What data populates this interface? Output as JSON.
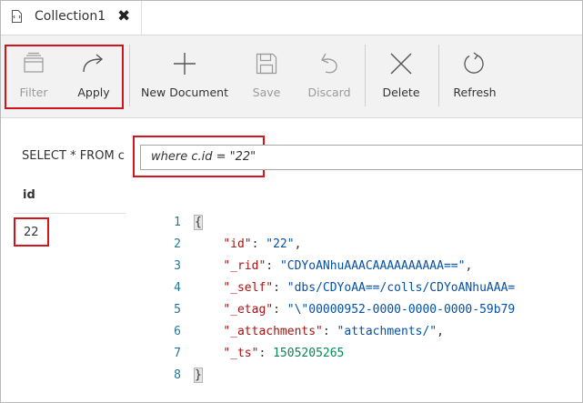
{
  "tab": {
    "title": "Collection1",
    "close": "✖"
  },
  "toolbar": {
    "filter_label": "Filter",
    "apply_label": "Apply",
    "new_document_label": "New Document",
    "save_label": "Save",
    "discard_label": "Discard",
    "delete_label": "Delete",
    "refresh_label": "Refresh"
  },
  "query": {
    "prefix": "SELECT * FROM c",
    "value": "where c.id = \"22\""
  },
  "results": {
    "column_header": "id",
    "rows": [
      "22"
    ]
  },
  "editor": {
    "line_numbers": [
      "1",
      "2",
      "3",
      "4",
      "5",
      "6",
      "7",
      "8"
    ],
    "lines": [
      {
        "open": "{"
      },
      {
        "key": "\"id\"",
        "value": "\"22\"",
        "trail": ","
      },
      {
        "key": "\"_rid\"",
        "value": "\"CDYoANhuAAACAAAAAAAAAA==\"",
        "trail": ","
      },
      {
        "key": "\"_self\"",
        "value": "\"dbs/CDYoAA==/colls/CDYoANhuAAA=",
        "trail": ""
      },
      {
        "key": "\"_etag\"",
        "value": "\"\\\"00000952-0000-0000-0000-59b79",
        "trail": ""
      },
      {
        "key": "\"_attachments\"",
        "value": "\"attachments/\"",
        "trail": ","
      },
      {
        "key": "\"_ts\"",
        "value": "1505205265",
        "trail": ""
      },
      {
        "close": "}"
      }
    ]
  },
  "colors": {
    "highlight_box": "#d2151c",
    "toolbar_bg": "#f2f2f2",
    "line_number": "#237893",
    "json_key": "#a31515",
    "json_string": "#0451a5",
    "json_number": "#098658"
  }
}
